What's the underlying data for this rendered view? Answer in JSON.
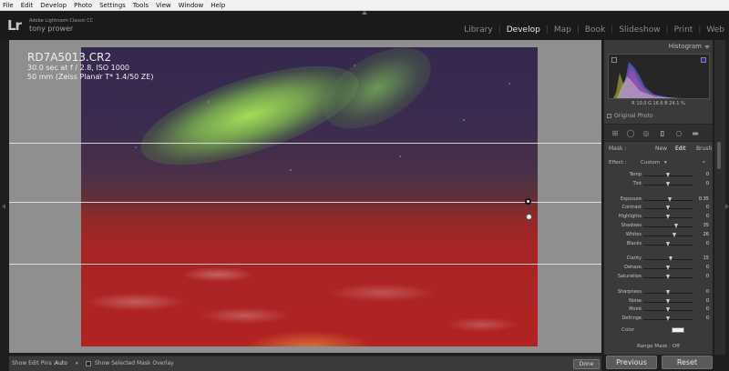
{
  "menubar": [
    "File",
    "Edit",
    "Develop",
    "Photo",
    "Settings",
    "Tools",
    "View",
    "Window",
    "Help"
  ],
  "identity": {
    "logo": "Lr",
    "product": "Adobe Lightroom Classic CC",
    "user": "tony prower"
  },
  "modules": [
    {
      "label": "Library",
      "active": false
    },
    {
      "label": "Develop",
      "active": true
    },
    {
      "label": "Map",
      "active": false
    },
    {
      "label": "Book",
      "active": false
    },
    {
      "label": "Slideshow",
      "active": false
    },
    {
      "label": "Print",
      "active": false
    },
    {
      "label": "Web",
      "active": false
    }
  ],
  "photo": {
    "filename": "RD7A5013.CR2",
    "exposure_line": "30.0 sec at f / 2.8, ISO 1000",
    "lens_line": "50 mm (Zeiss Planar T* 1.4/50 ZE)"
  },
  "toolbar": {
    "edit_pins_label": "Show Edit Pins :",
    "edit_pins_value": "Auto",
    "mask_overlay_label": "Show Selected Mask Overlay",
    "done_label": "Done"
  },
  "histogram": {
    "title": "Histogram",
    "readout": "R 10.0 G 16.6 B 24.1 %"
  },
  "original_photo_label": "Original Photo",
  "mask": {
    "label": "Mask :",
    "new": "New",
    "edit": "Edit",
    "brush": "Brush"
  },
  "effect": {
    "label": "Effect :",
    "value": "Custom"
  },
  "sliders": [
    {
      "name": "Temp",
      "value": "0",
      "pos": 0.5
    },
    {
      "name": "Tint",
      "value": "0",
      "pos": 0.5
    },
    {
      "gap": true
    },
    {
      "name": "Exposure",
      "value": "0.35",
      "pos": 0.55
    },
    {
      "name": "Contrast",
      "value": "0",
      "pos": 0.5
    },
    {
      "name": "Highlights",
      "value": "0",
      "pos": 0.5
    },
    {
      "name": "Shadows",
      "value": "35",
      "pos": 0.67
    },
    {
      "name": "Whites",
      "value": "26",
      "pos": 0.63
    },
    {
      "name": "Blacks",
      "value": "0",
      "pos": 0.5
    },
    {
      "gap": true
    },
    {
      "name": "Clarity",
      "value": "15",
      "pos": 0.57
    },
    {
      "name": "Dehaze",
      "value": "0",
      "pos": 0.5
    },
    {
      "name": "Saturation",
      "value": "0",
      "pos": 0.5
    },
    {
      "gap": true
    },
    {
      "name": "Sharpness",
      "value": "0",
      "pos": 0.5
    },
    {
      "name": "Noise",
      "value": "0",
      "pos": 0.5
    },
    {
      "name": "Moiré",
      "value": "0",
      "pos": 0.5
    },
    {
      "name": "Defringe",
      "value": "0",
      "pos": 0.5
    }
  ],
  "color_label": "Color",
  "range_mask": "Range Mask : Off",
  "buttons": {
    "previous": "Previous",
    "reset": "Reset"
  }
}
